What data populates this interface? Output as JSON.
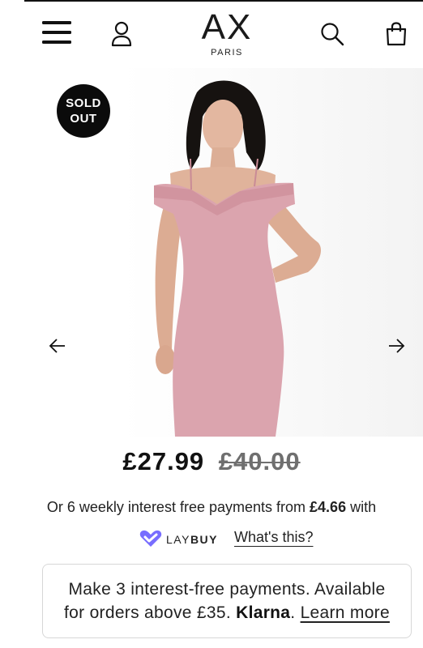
{
  "header": {
    "logo_mark": "AX",
    "logo_sub": "PARIS"
  },
  "product": {
    "badge_line1": "SOLD",
    "badge_line2": "OUT",
    "price_now": "£27.99",
    "price_was": "£40.00"
  },
  "laybuy": {
    "text_before": "Or 6 weekly interest free payments from",
    "amount": "£4.66",
    "text_after": "with",
    "brand_light": "LAY",
    "brand_bold": "BUY",
    "whats_this": "What's this?",
    "brand_color": "#786dff"
  },
  "klarna": {
    "line1": "Make 3 interest-free payments. Available",
    "line2_start": "for orders above £35.",
    "brand": "Klarna",
    "period": ".",
    "learn_more": "Learn more"
  },
  "icons": {
    "menu": "hamburger-menu-icon",
    "account": "user-icon",
    "search": "search-icon",
    "bag": "shopping-bag-icon",
    "prev": "arrow-left-icon",
    "next": "arrow-right-icon"
  }
}
